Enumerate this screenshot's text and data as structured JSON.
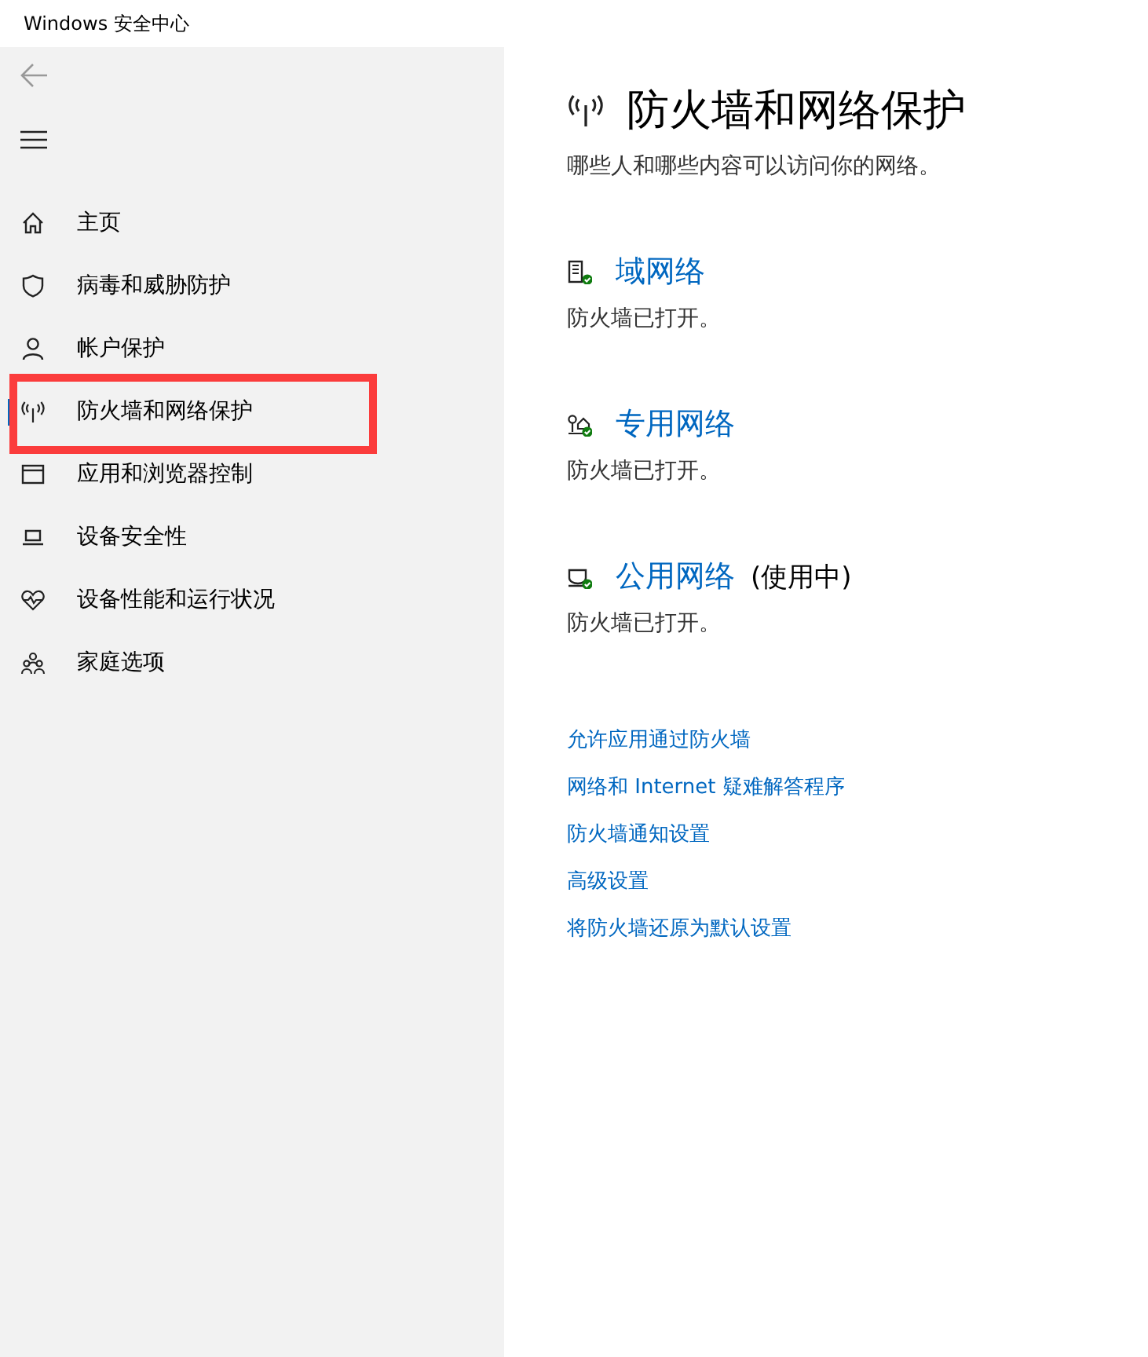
{
  "window": {
    "title": "Windows 安全中心"
  },
  "sidebar": {
    "items": [
      {
        "kind": "home",
        "label": "主页",
        "selected": false
      },
      {
        "kind": "shield",
        "label": "病毒和威胁防护",
        "selected": false
      },
      {
        "kind": "person",
        "label": "帐户保护",
        "selected": false
      },
      {
        "kind": "antenna",
        "label": "防火墙和网络保护",
        "selected": true,
        "highlighted": true
      },
      {
        "kind": "window",
        "label": "应用和浏览器控制",
        "selected": false
      },
      {
        "kind": "laptop",
        "label": "设备安全性",
        "selected": false
      },
      {
        "kind": "heart",
        "label": "设备性能和运行状况",
        "selected": false
      },
      {
        "kind": "family",
        "label": "家庭选项",
        "selected": false
      }
    ]
  },
  "page": {
    "title": "防火墙和网络保护",
    "subtitle": "哪些人和哪些内容可以访问你的网络。"
  },
  "networks": [
    {
      "kind": "domain",
      "name": "域网络",
      "status": "防火墙已打开。"
    },
    {
      "kind": "private",
      "name": "专用网络",
      "status": "防火墙已打开。"
    },
    {
      "kind": "public",
      "name": "公用网络",
      "note": "(使用中)",
      "status": "防火墙已打开。"
    }
  ],
  "links": [
    "允许应用通过防火墙",
    "网络和 Internet 疑难解答程序",
    "防火墙通知设置",
    "高级设置",
    "将防火墙还原为默认设置"
  ]
}
